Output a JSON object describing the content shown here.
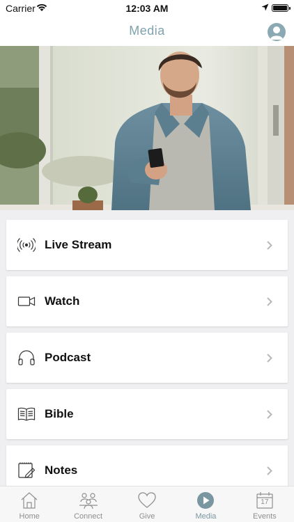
{
  "status_bar": {
    "carrier": "Carrier",
    "time": "12:03 AM"
  },
  "header": {
    "title": "Media",
    "profile_icon": "person-circle-icon"
  },
  "hero": {
    "description_icon": "man-with-phone-photo"
  },
  "menu": {
    "items": [
      {
        "label": "Live Stream",
        "icon": "broadcast-icon"
      },
      {
        "label": "Watch",
        "icon": "video-camera-icon"
      },
      {
        "label": "Podcast",
        "icon": "headphones-icon"
      },
      {
        "label": "Bible",
        "icon": "open-book-icon"
      },
      {
        "label": "Notes",
        "icon": "notepad-icon"
      }
    ]
  },
  "tab_bar": {
    "tabs": [
      {
        "label": "Home",
        "icon": "house-icon"
      },
      {
        "label": "Connect",
        "icon": "people-icon"
      },
      {
        "label": "Give",
        "icon": "heart-icon"
      },
      {
        "label": "Media",
        "icon": "play-circle-icon",
        "active": true
      },
      {
        "label": "Events",
        "icon": "calendar-icon",
        "day": "17"
      }
    ]
  },
  "colors": {
    "accent": "#7a96a0",
    "title": "#7fa3ad",
    "inactive": "#8e8e8e"
  }
}
